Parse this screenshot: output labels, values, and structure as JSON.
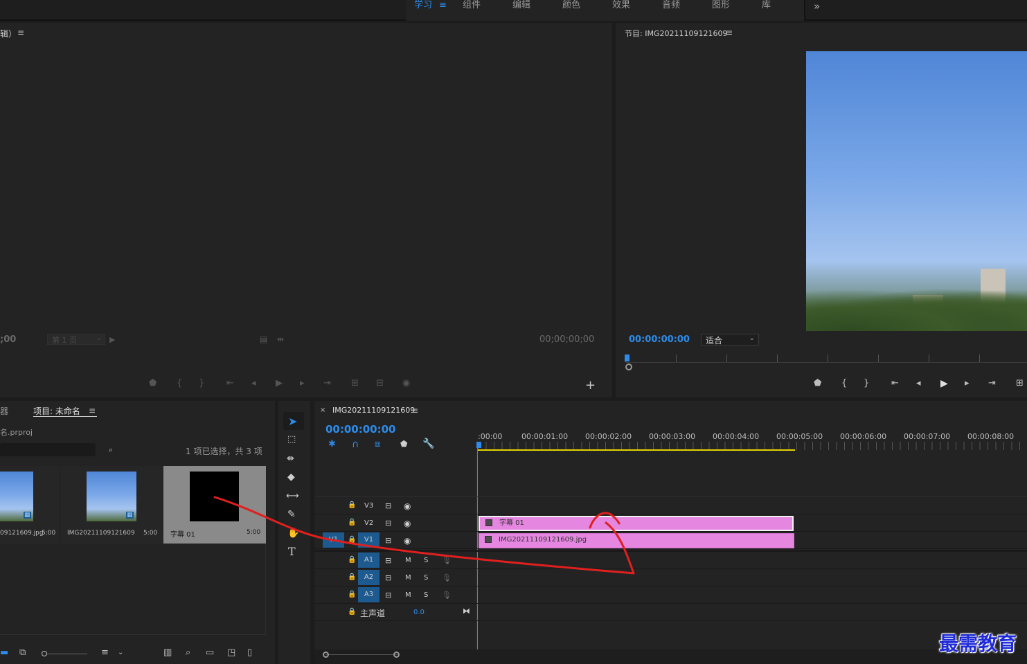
{
  "workspace_tabs": [
    "学习",
    "组件",
    "编辑",
    "颜色",
    "效果",
    "音频",
    "图形",
    "库"
  ],
  "workspace_more": "»",
  "source_monitor": {
    "title": "辑）",
    "timecode": ";00",
    "page_select": "第 1 页",
    "end_timecode": "00;00;00;00"
  },
  "program_monitor": {
    "title": "节目: IMG20211109121609",
    "timecode": "00:00:00:00",
    "fit_label": "适合"
  },
  "project_panel": {
    "tab_left": "器",
    "tab_title": "项目: 未命名",
    "file_name": "名.prproj",
    "selection_info": "1 项已选择，共 3 项",
    "items": [
      {
        "name": "09121609.jpg",
        "duration": "5:00"
      },
      {
        "name": "IMG20211109121609",
        "duration": "5:00"
      },
      {
        "name": "字幕 01",
        "duration": "5:00"
      }
    ]
  },
  "timeline": {
    "sequence_name": "IMG20211109121609",
    "timecode": "00:00:00:00",
    "ruler": [
      ":00:00",
      "00:00:01:00",
      "00:00:02:00",
      "00:00:03:00",
      "00:00:04:00",
      "00:00:05:00",
      "00:00:06:00",
      "00:00:07:00",
      "00:00:08:00"
    ],
    "video_tracks": [
      "V3",
      "V2",
      "V1"
    ],
    "audio_tracks": [
      "A1",
      "A2",
      "A3"
    ],
    "source_patch": "V1",
    "mute_label": "M",
    "solo_label": "S",
    "master_label": "主声道",
    "master_value": "0.0",
    "clips": [
      {
        "name": "字幕 01",
        "track": "V2"
      },
      {
        "name": "IMG20211109121609.jpg",
        "track": "V1"
      }
    ]
  },
  "watermark": "最需教育",
  "colors": {
    "accent": "#2d8ceb",
    "clip": "#e586e0",
    "annotation": "#e0201e"
  }
}
